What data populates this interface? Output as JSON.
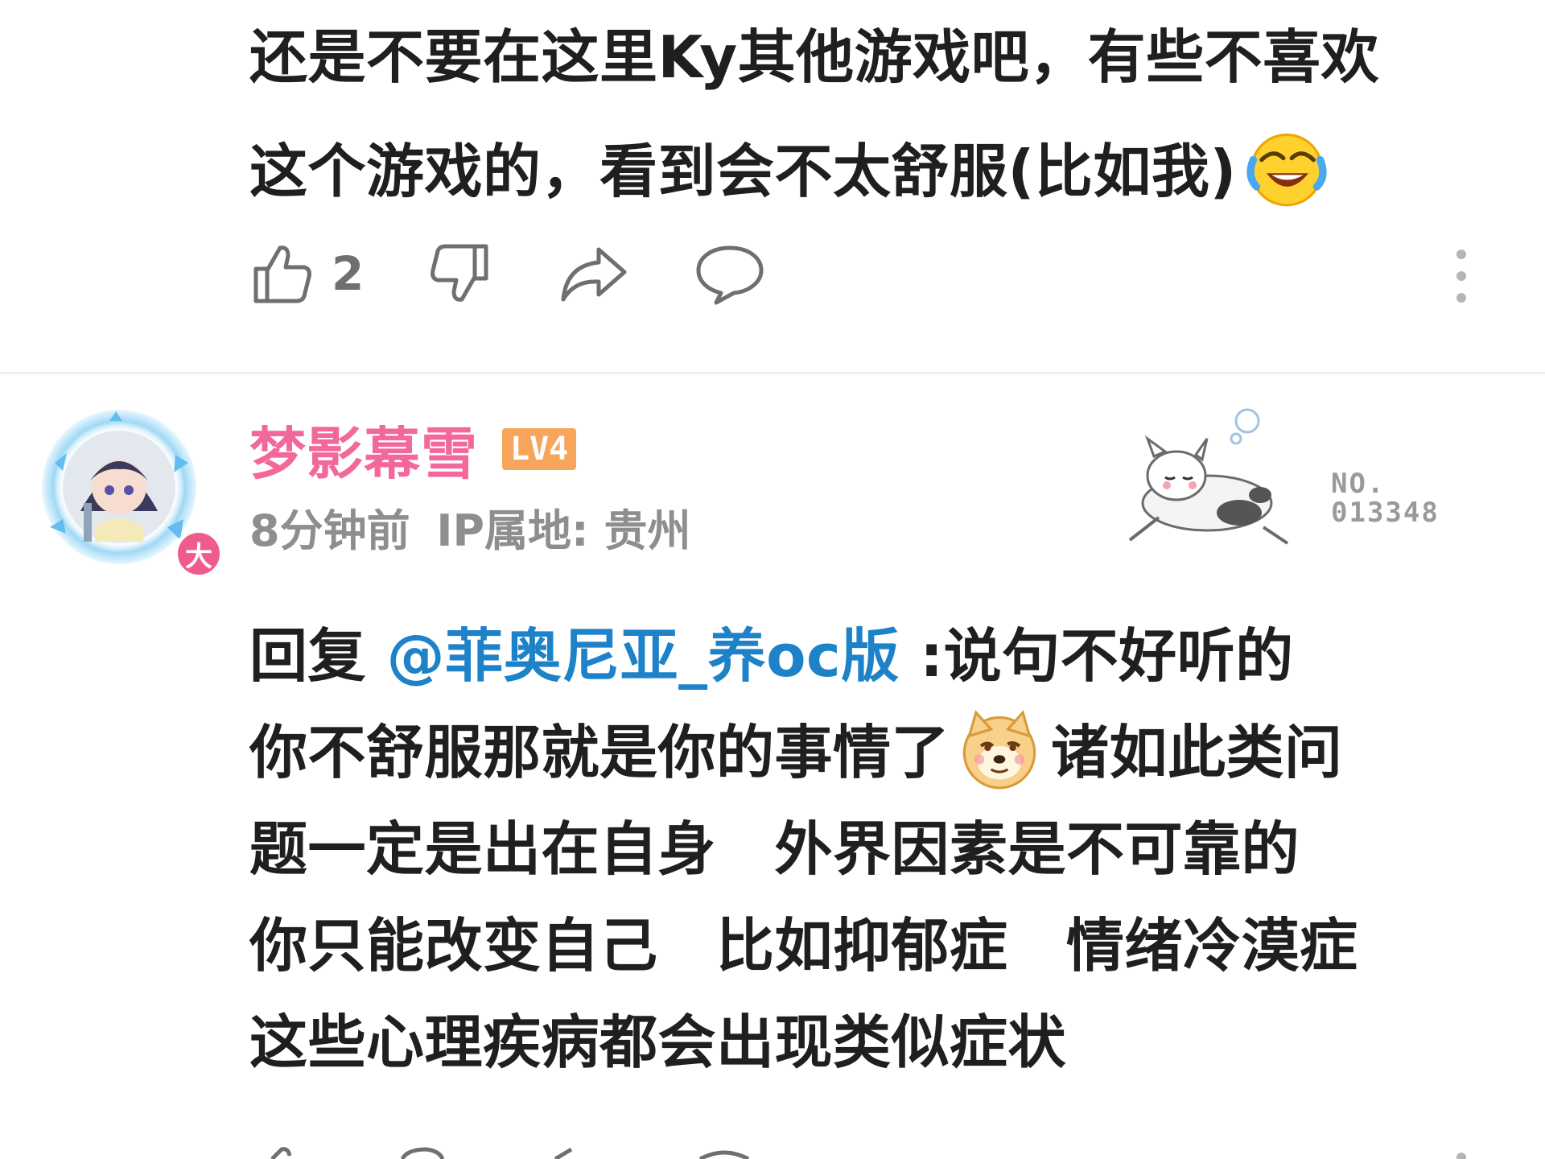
{
  "top_comment": {
    "text_line1": "还是不要在这里Ky其他游戏吧，有些不喜欢",
    "text_line2": "这个游戏的，看到会不太舒服(比如我)",
    "emoji": "laughing-crying-emoji",
    "like_count": "2",
    "icons": [
      "thumbs-up-icon",
      "thumbs-down-icon",
      "share-icon",
      "comment-icon",
      "more-vertical-icon"
    ]
  },
  "second_comment": {
    "username": "梦影幕雪",
    "level": "LV4",
    "avatar_badge": "大",
    "time": "8分钟前",
    "ip_label": "IP属地: 贵州",
    "decoration_no_label": "NO.",
    "decoration_no_value": "013348",
    "reply_prefix": "回复 ",
    "mention": "@菲奥尼亚_养oc版",
    "reply_line1_rest": " :说句不好听的",
    "reply_line2_a": "你不舒服那就是你的事情了",
    "reply_line2_b": "诸如此类问",
    "reply_line3": "题一定是出在自身　外界因素是不可靠的",
    "reply_line4": "你只能改变自己　比如抑郁症　情绪冷漠症",
    "reply_line5": "这些心理疾病都会出现类似症状",
    "emoji": "doge-emoji"
  },
  "colors": {
    "username": "#f2689a",
    "mention": "#1e82c8",
    "level_badge": "#f7a55d",
    "meta": "#8e8e8e",
    "icon": "#6f6f6f",
    "divider": "#efefef"
  }
}
